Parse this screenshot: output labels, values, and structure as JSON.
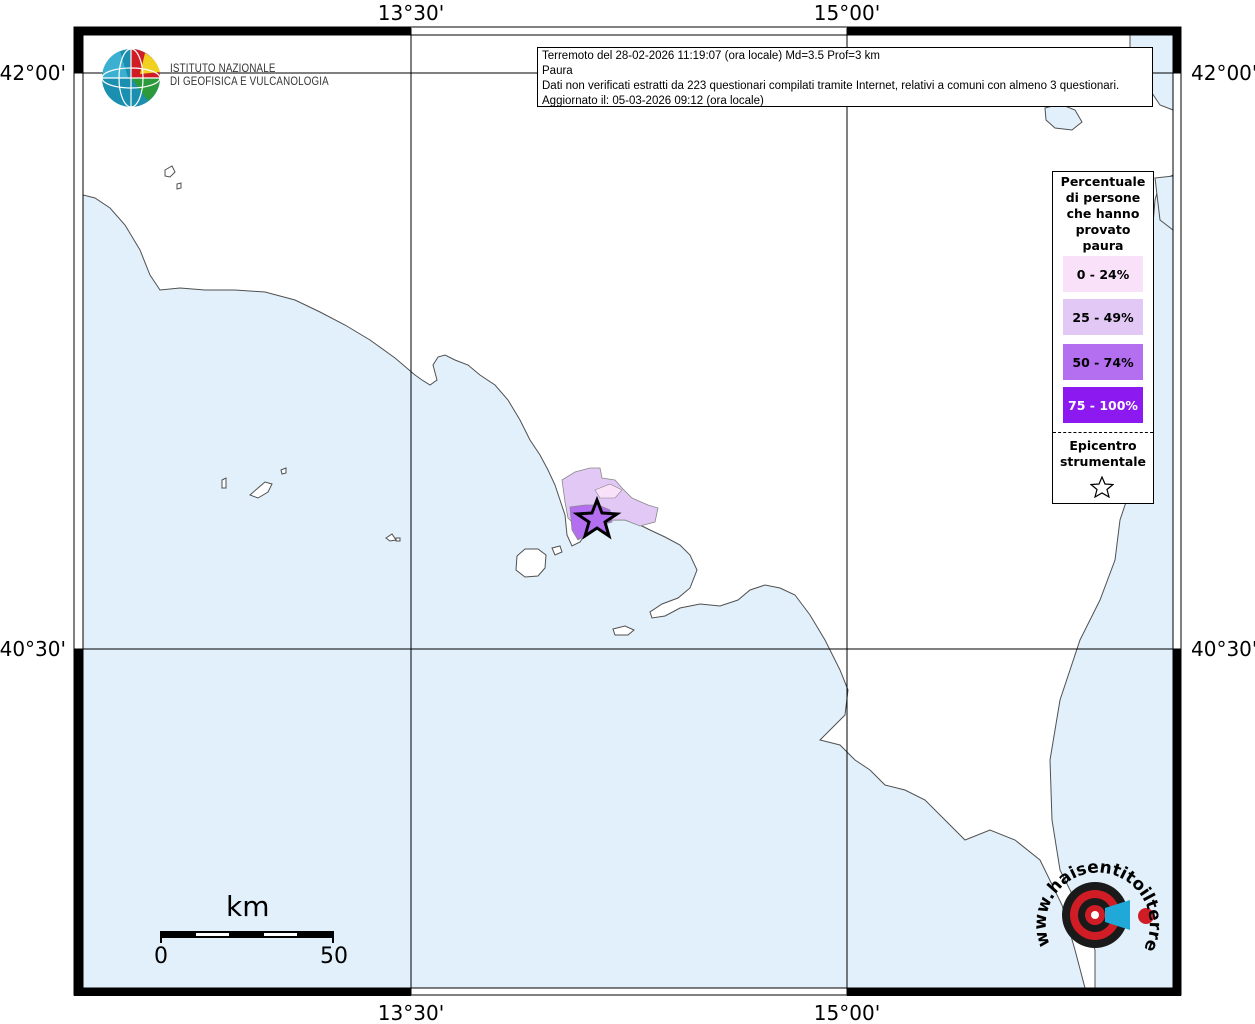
{
  "axes": {
    "lon_top": [
      "13°30'",
      "15°00'"
    ],
    "lon_bottom": [
      "13°30'",
      "15°00'"
    ],
    "lat_left": [
      "42°00'",
      "40°30'"
    ],
    "lat_right": [
      "42°00'",
      "40°30'"
    ]
  },
  "info": {
    "line1": "Terremoto del 28-02-2026 11:19:07 (ora locale) Md=3.5 Prof=3 km",
    "line2": "Paura",
    "line3": "Dati non verificati estratti da 223 questionari compilati tramite Internet, relativi a comuni con almeno 3 questionari.",
    "line4": "Aggiornato il: 05-03-2026 09:12 (ora locale)"
  },
  "logo": {
    "line1": "ISTITUTO NAZIONALE",
    "line2": "DI GEOFISICA E VULCANOLOGIA",
    "icon": "ingv-globe-icon"
  },
  "legend": {
    "title": [
      "Percentuale",
      "di persone",
      "che hanno",
      "provato",
      "paura"
    ],
    "items": [
      {
        "label": "0 - 24%",
        "color": "#fae1fa",
        "text_color": "#000000"
      },
      {
        "label": "25 - 49%",
        "color": "#e1c8f5",
        "text_color": "#000000"
      },
      {
        "label": "50 - 74%",
        "color": "#b46ef0",
        "text_color": "#000000"
      },
      {
        "label": "75 - 100%",
        "color": "#8c19f0",
        "text_color": "#ffffff"
      }
    ],
    "epicenter": [
      "Epicentro",
      "strumentale"
    ],
    "epicenter_icon": "star-icon"
  },
  "scale": {
    "unit": "km",
    "min": "0",
    "max": "50"
  },
  "badge": {
    "text": "www.haisentitoilterremoto.it",
    "icon": "earthquake-target-icon"
  },
  "colors": {
    "sea": "#e1f0fa",
    "land": "#ffffff",
    "coast": "#505050"
  }
}
